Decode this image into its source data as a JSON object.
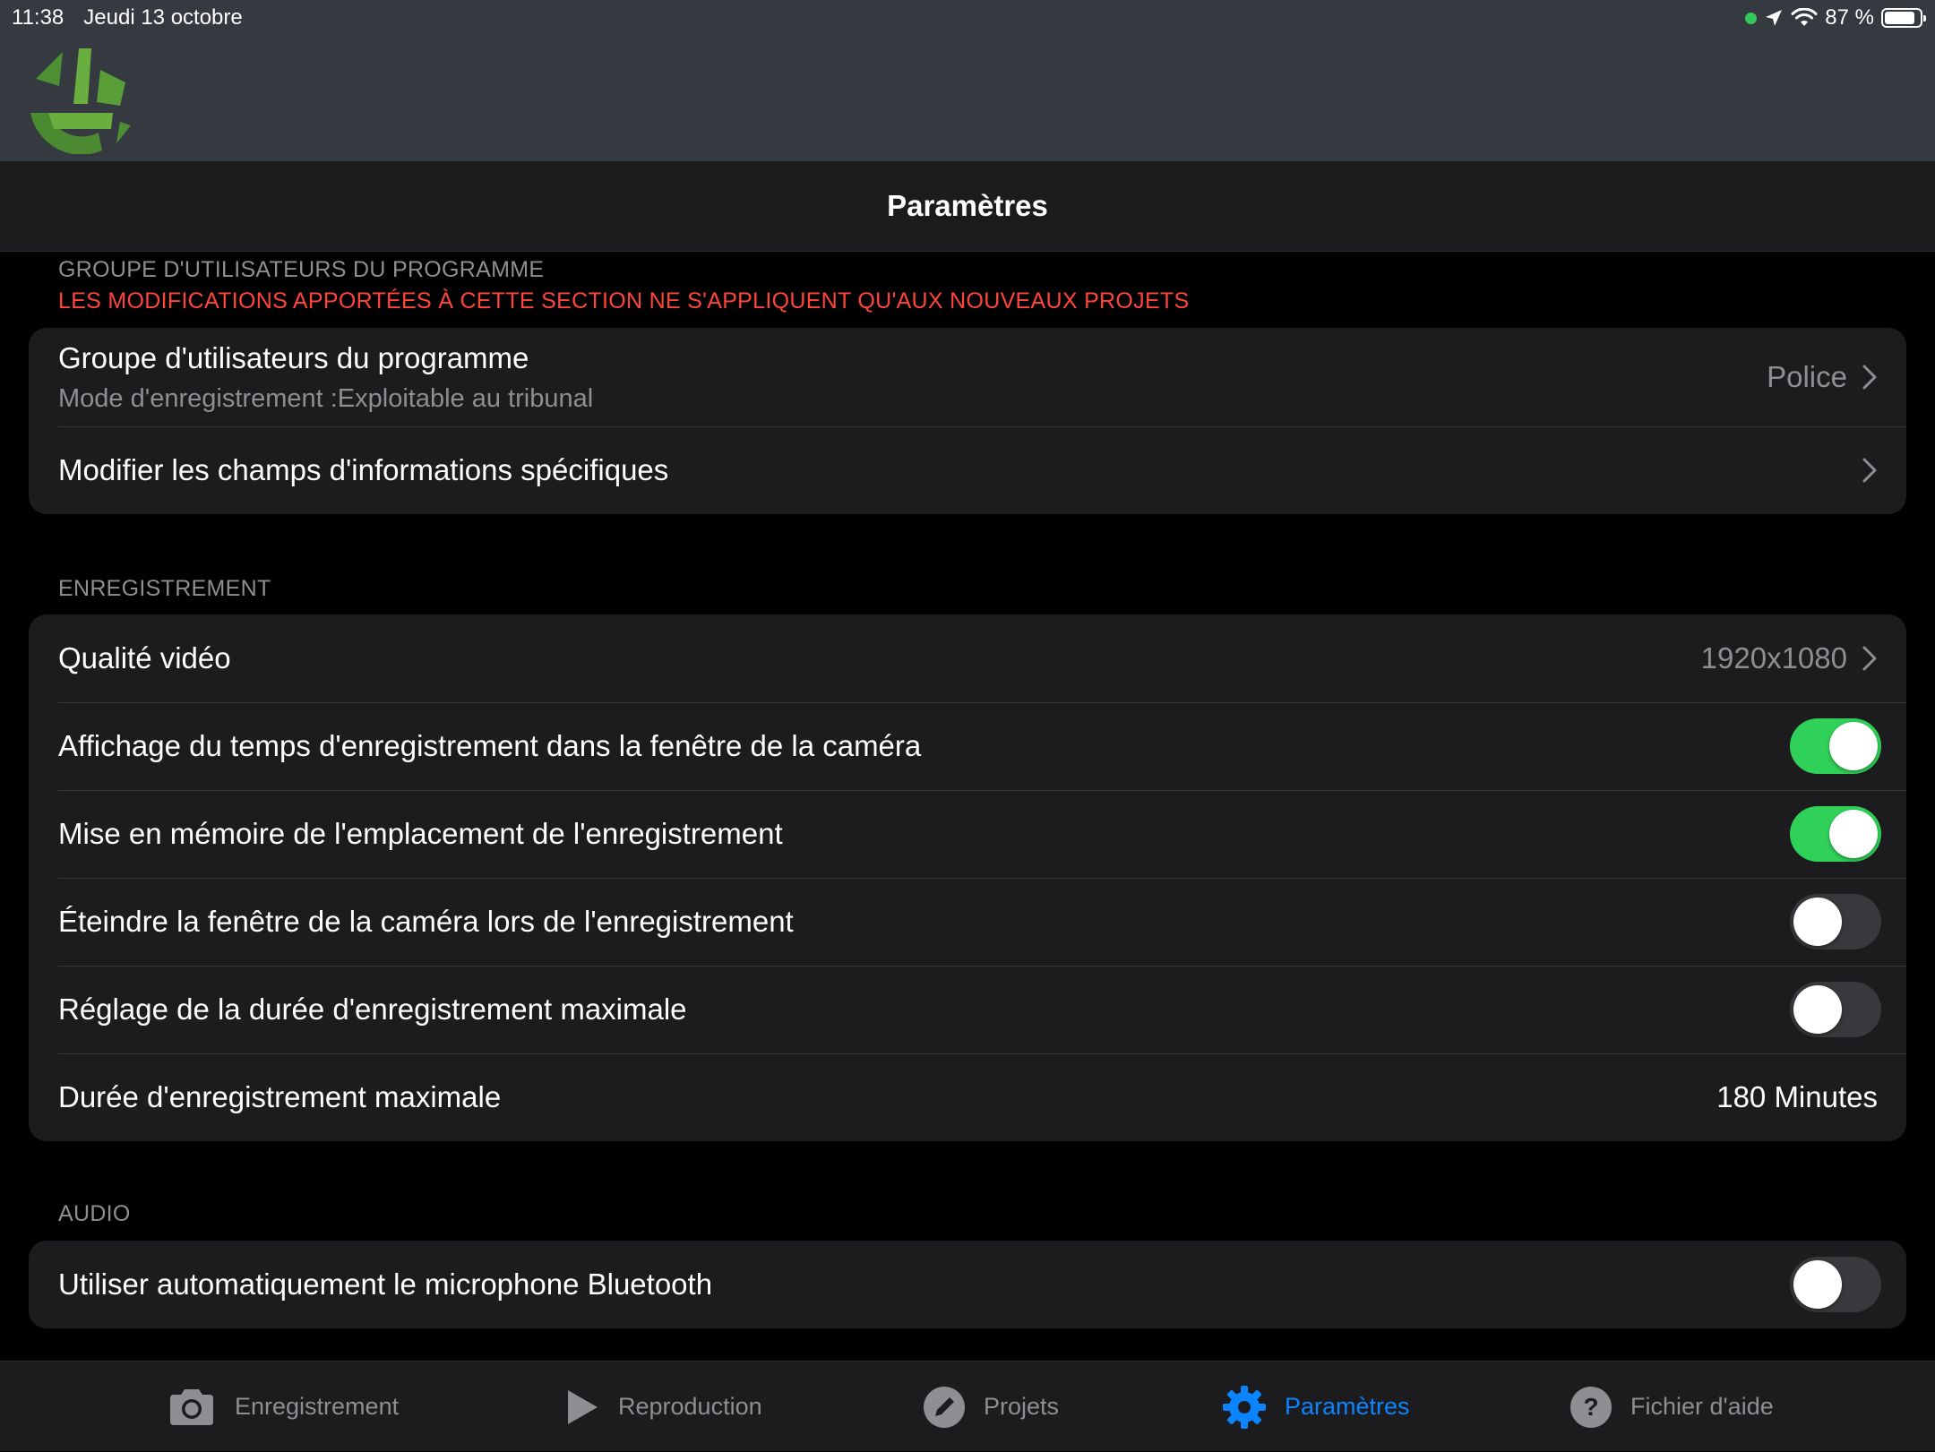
{
  "status_bar": {
    "time": "11:38",
    "date": "Jeudi 13 octobre",
    "battery": "87 %",
    "battery_level": 0.87
  },
  "nav": {
    "title": "Paramètres"
  },
  "sections": {
    "group": {
      "header": "GROUPE D'UTILISATEURS DU PROGRAMME",
      "warning": "LES MODIFICATIONS APPORTÉES À CETTE SECTION NE S'APPLIQUENT QU'AUX NOUVEAUX PROJETS",
      "rows": {
        "user_group": {
          "title": "Groupe d'utilisateurs du programme",
          "subtitle": "Mode d'enregistrement :Exploitable au tribunal",
          "value": "Police"
        },
        "edit_fields": {
          "title": "Modifier les champs d'informations spécifiques"
        }
      }
    },
    "recording": {
      "header": "ENREGISTREMENT",
      "rows": {
        "video_quality": {
          "title": "Qualité vidéo",
          "value": "1920x1080"
        },
        "show_time": {
          "title": "Affichage du temps d'enregistrement dans la fenêtre de la caméra",
          "on": true
        },
        "remember_location": {
          "title": "Mise en mémoire de l'emplacement de l'enregistrement",
          "on": true
        },
        "turn_off_camera": {
          "title": "Éteindre la fenêtre de la caméra lors de l'enregistrement",
          "on": false
        },
        "max_duration_setting": {
          "title": "Réglage de la durée d'enregistrement maximale",
          "on": false
        },
        "max_duration": {
          "title": "Durée d'enregistrement maximale",
          "value": "180 Minutes"
        }
      }
    },
    "audio": {
      "header": "AUDIO",
      "rows": {
        "bluetooth_mic": {
          "title": "Utiliser automatiquement le microphone Bluetooth",
          "on": false
        }
      }
    }
  },
  "tabs": [
    {
      "label": "Enregistrement",
      "icon": "camera-icon",
      "active": false
    },
    {
      "label": "Reproduction",
      "icon": "play-icon",
      "active": false
    },
    {
      "label": "Projets",
      "icon": "pencil-icon",
      "active": false
    },
    {
      "label": "Paramètres",
      "icon": "gear-icon",
      "active": true
    },
    {
      "label": "Fichier d'aide",
      "icon": "question-icon",
      "active": false
    }
  ],
  "colors": {
    "accent": "#0a84ff",
    "toggle_on": "#30d158",
    "warning": "#ff453a",
    "header_bg": "#343a40",
    "logo_green": "#5a9e3a"
  }
}
